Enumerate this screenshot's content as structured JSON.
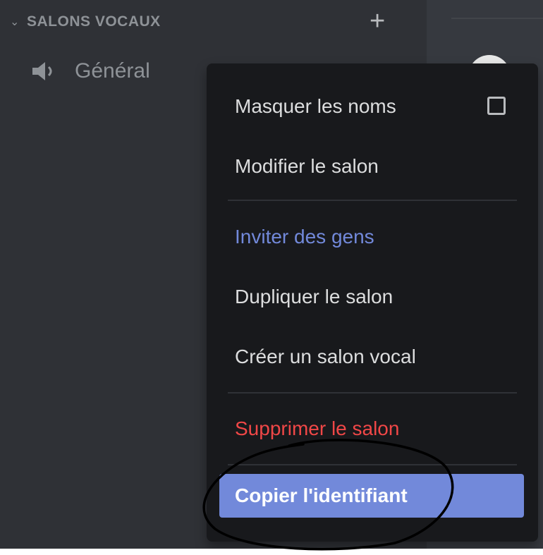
{
  "sidebar": {
    "category": {
      "title": "SALONS VOCAUX",
      "chevron_icon": "chevron-down-icon",
      "add_icon": "plus-icon"
    },
    "channel": {
      "icon": "speaker-icon",
      "name": "Général"
    }
  },
  "context_menu": {
    "items": [
      {
        "label": "Masquer les noms",
        "checkbox": false
      },
      {
        "label": "Modifier le salon"
      },
      {
        "label": "Inviter des gens",
        "color": "#7289da"
      },
      {
        "label": "Dupliquer le salon"
      },
      {
        "label": "Créer un salon vocal"
      },
      {
        "label": "Supprimer le salon",
        "color": "#f04747"
      },
      {
        "label": "Copier l'identifiant",
        "selected": true
      }
    ]
  },
  "colors": {
    "accent": "#7289da",
    "danger": "#f04747",
    "menu_bg": "#18191c",
    "sidebar_bg": "#2f3136"
  }
}
